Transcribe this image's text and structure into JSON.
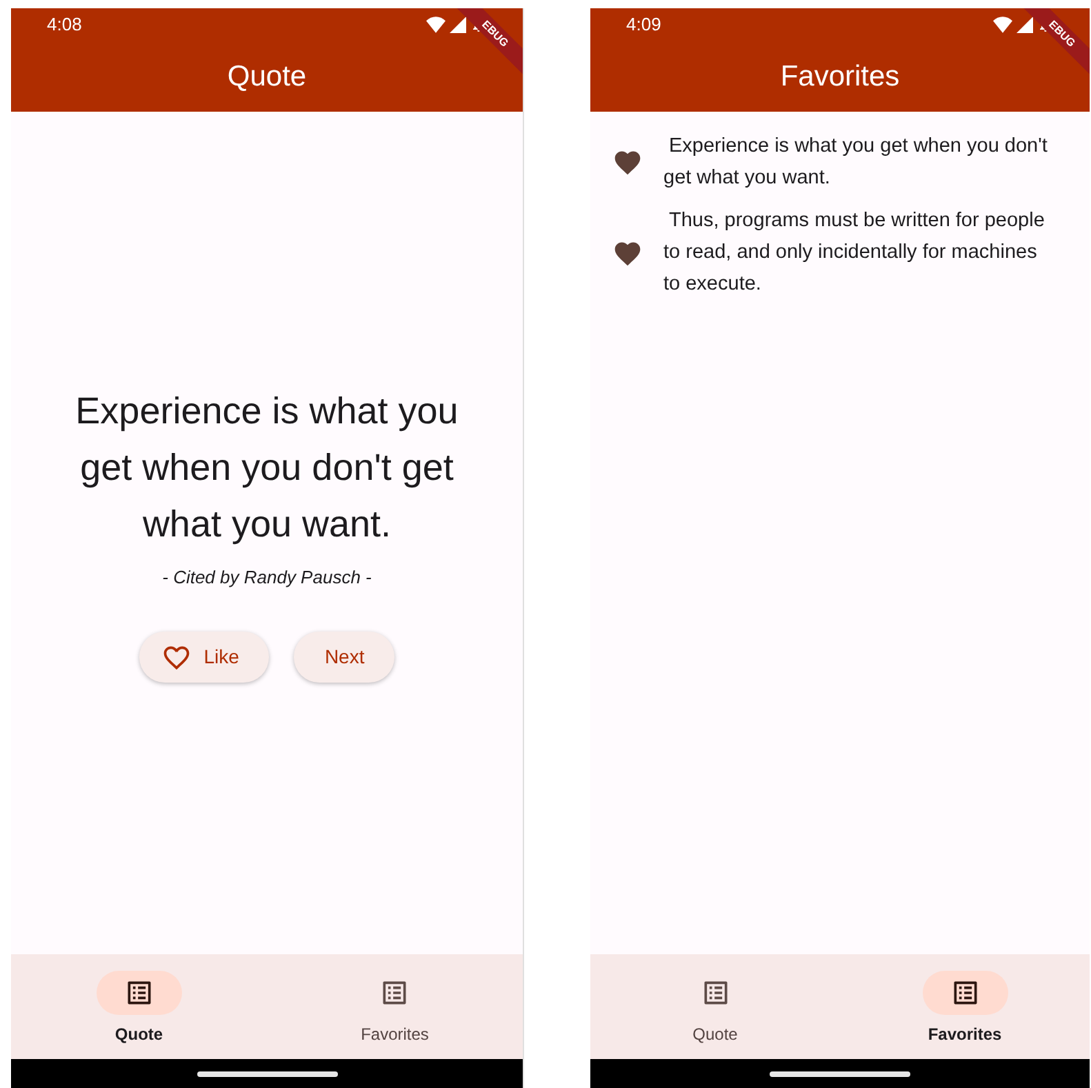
{
  "screens": [
    {
      "kind": "quote",
      "status_bar": {
        "time": "4:08"
      },
      "debug_banner": "EBUG",
      "app_bar": {
        "title": "Quote"
      },
      "quote": {
        "text": "Experience is what you get when you don't get what you want.",
        "citation": "- Cited by Randy Pausch -"
      },
      "buttons": [
        {
          "kind": "like",
          "label": "Like"
        },
        {
          "kind": "next",
          "label": "Next"
        }
      ],
      "nav": [
        {
          "label": "Quote",
          "selected": true
        },
        {
          "label": "Favorites",
          "selected": false
        }
      ]
    },
    {
      "kind": "favorites",
      "status_bar": {
        "time": "4:09"
      },
      "debug_banner": "EBUG",
      "app_bar": {
        "title": "Favorites"
      },
      "favorites": [
        {
          "text": "Experience is what you get when you don't get what you want."
        },
        {
          "text": "Thus, programs must be written for people to read, and only incidentally for machines to execute."
        }
      ],
      "nav": [
        {
          "label": "Quote",
          "selected": false
        },
        {
          "label": "Favorites",
          "selected": true
        }
      ]
    }
  ]
}
